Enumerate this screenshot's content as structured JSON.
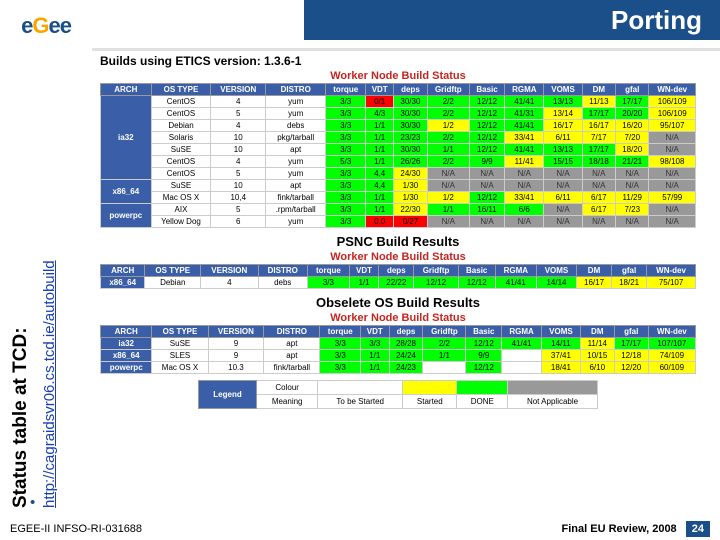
{
  "header": {
    "title": "Porting",
    "logo": "eGee"
  },
  "sidebar": {
    "main": "Status table at TCD:",
    "link": "http://cagraidsvr06.cs.tcd.ie/autobuild"
  },
  "sections": {
    "etics_title": "Builds using ETICS version: 1.3.6-1",
    "table1_title": "Worker Node Build Status",
    "table2_title": "PSNC Build Results",
    "table2_sub": "Worker Node Build Status",
    "table3_title": "Obselete OS Build Results",
    "table3_sub": "Worker Node Build Status"
  },
  "cols": [
    "ARCH",
    "OS TYPE",
    "VERSION",
    "DISTRO",
    "torque",
    "VDT",
    "deps",
    "Gridftp",
    "Basic",
    "RGMA",
    "VOMS",
    "DM",
    "gfal",
    "WN-dev"
  ],
  "t1": [
    {
      "arch": "ia32",
      "rows": [
        [
          "CentOS",
          "4",
          "yum",
          "3/3",
          "0/1",
          "30/30",
          "2/2",
          "12/12",
          "41/41",
          "13/13",
          "11/13",
          "17/17",
          "106/109"
        ],
        [
          "CentOS",
          "5",
          "yum",
          "3/3",
          "4/3",
          "30/30",
          "2/2",
          "12/12",
          "41/31",
          "13/14",
          "17/17",
          "20/20",
          "106/109"
        ],
        [
          "Debian",
          "4",
          "debs",
          "3/3",
          "1/1",
          "30/30",
          "1/2",
          "12/12",
          "41/41",
          "16/17",
          "16/17",
          "16/20",
          "95/107"
        ],
        [
          "Solaris",
          "10",
          "pkg/tarball",
          "3/3",
          "1/1",
          "23/23",
          "2/2",
          "12/12",
          "33/41",
          "6/11",
          "7/17",
          "7/20",
          "N/A"
        ],
        [
          "SuSE",
          "10",
          "apt",
          "3/3",
          "1/1",
          "30/30",
          "1/1",
          "12/12",
          "41/41",
          "13/13",
          "17/17",
          "18/20",
          "N/A"
        ],
        [
          "CentOS",
          "4",
          "yum",
          "5/3",
          "1/1",
          "26/26",
          "2/2",
          "9/9",
          "11/41",
          "15/15",
          "18/18",
          "21/21",
          "98/108"
        ],
        [
          "CentOS",
          "5",
          "yum",
          "3/3",
          "4,4",
          "24/30",
          "N/A",
          "N/A",
          "N/A",
          "N/A",
          "N/A",
          "N/A",
          "N/A"
        ]
      ]
    },
    {
      "arch": "x86_64",
      "rows": [
        [
          "SuSE",
          "10",
          "apt",
          "3/3",
          "4,4",
          "1/30",
          "N/A",
          "N/A",
          "N/A",
          "N/A",
          "N/A",
          "N/A",
          "N/A"
        ],
        [
          "Mac OS X",
          "10,4",
          "fink/tarball",
          "3/3",
          "1/1",
          "1/30",
          "1/2",
          "12/12",
          "33/41",
          "6/11",
          "6/17",
          "11/29",
          "57/99"
        ]
      ]
    },
    {
      "arch": "powerpc",
      "rows": [
        [
          "AIX",
          "5",
          ".rpm/tarball",
          "3/3",
          "1/1",
          "22/30",
          "1/1",
          "16/11",
          "6/6",
          "N/A",
          "6/17",
          "7/23",
          "N/A"
        ],
        [
          "Yellow Dog",
          "6",
          "yum",
          "3/3",
          "0.0",
          "0/27",
          "N/A",
          "N/A",
          "N/A",
          "N/A",
          "N/A",
          "N/A",
          "N/A"
        ]
      ]
    }
  ],
  "t2": [
    {
      "arch": "x86_64",
      "rows": [
        [
          "Debian",
          "4",
          "debs",
          "3/3",
          "1/1",
          "22/22",
          "12/12",
          "12/12",
          "41/41",
          "14/14",
          "16/17",
          "18/21",
          "75/107"
        ]
      ]
    }
  ],
  "t3": [
    {
      "arch": "ia32",
      "rows": [
        [
          "SuSE",
          "9",
          "apt",
          "3/3",
          "3/3",
          "28/28",
          "2/2",
          "12/12",
          "41/41",
          "14/11",
          "11/14",
          "17/17",
          "107/107"
        ]
      ]
    },
    {
      "arch": "x86_64",
      "rows": [
        [
          "SLES",
          "9",
          "apt",
          "3/3",
          "1/1",
          "24/24",
          "1/1",
          "9/9",
          "",
          "37/41",
          "10/15",
          "12/18",
          "74/109"
        ]
      ]
    },
    {
      "arch": "powerpc",
      "rows": [
        [
          "Mac OS X",
          "10.3",
          "fink/tarball",
          "3/3",
          "1/1",
          "24/23",
          "",
          "12/12",
          "",
          "18/41",
          "6/10",
          "12/20",
          "60/109"
        ]
      ]
    }
  ],
  "legend": {
    "labels": [
      "Legend",
      "Colour",
      "Meaning",
      "To be Started",
      "Started",
      "DONE",
      "Not Applicable"
    ]
  },
  "footer": {
    "left": "EGEE-II INFSO-RI-031688",
    "right": "Final EU Review, 2008",
    "page": "24"
  }
}
